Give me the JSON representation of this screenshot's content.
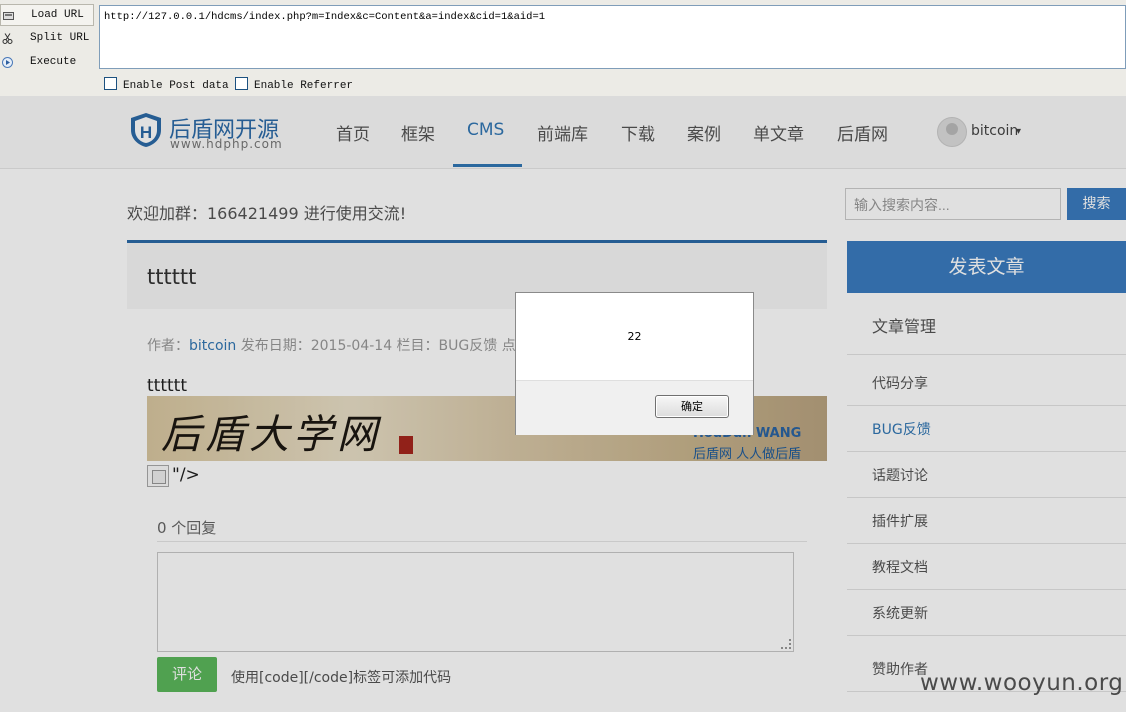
{
  "hackbar": {
    "load_url": "Load URL",
    "split_url": "Split URL",
    "execute": "Execute",
    "url": "http://127.0.0.1/hdcms/index.php?m=Index&c=Content&a=index&cid=1&aid=1",
    "enable_post": "Enable Post data",
    "enable_referrer": "Enable Referrer"
  },
  "site": {
    "logo_name": "后盾网开源",
    "logo_domain": "www.hdphp.com",
    "nav": [
      "首页",
      "框架",
      "CMS",
      "前端库",
      "下载",
      "案例",
      "单文章",
      "后盾网"
    ],
    "active_nav": "CMS",
    "user_name": "bitcoin",
    "notice": "欢迎加群：166421499 进行使用交流!",
    "search_placeholder": "输入搜索内容...",
    "search_button": "搜索",
    "accent_color": "#3277b4"
  },
  "article": {
    "title": "tttttt",
    "meta_author_label": "作者：",
    "meta_author": "bitcoin",
    "meta_rest": " 发布日期：2015-04-14 栏目：BUG反馈 点击：",
    "body_text": "tttttt",
    "banner_calligraphy": "后盾大学网",
    "banner_logo": "HouDun WANG",
    "banner_slogan": "后盾网  人人做后盾",
    "broken_tail": "\"/>",
    "reply_count": "0 个回复",
    "comment_button": "评论",
    "code_hint": "使用[code][/code]标签可添加代码"
  },
  "sidebar": {
    "post_button": "发表文章",
    "manage": "文章管理",
    "items": [
      "代码分享",
      "BUG反馈",
      "话题讨论",
      "插件扩展",
      "教程文档",
      "系统更新",
      "赞助作者"
    ],
    "active_item": "BUG反馈"
  },
  "alert": {
    "message": "22",
    "ok_button": "确定"
  },
  "watermark": "www.wooyun.org"
}
